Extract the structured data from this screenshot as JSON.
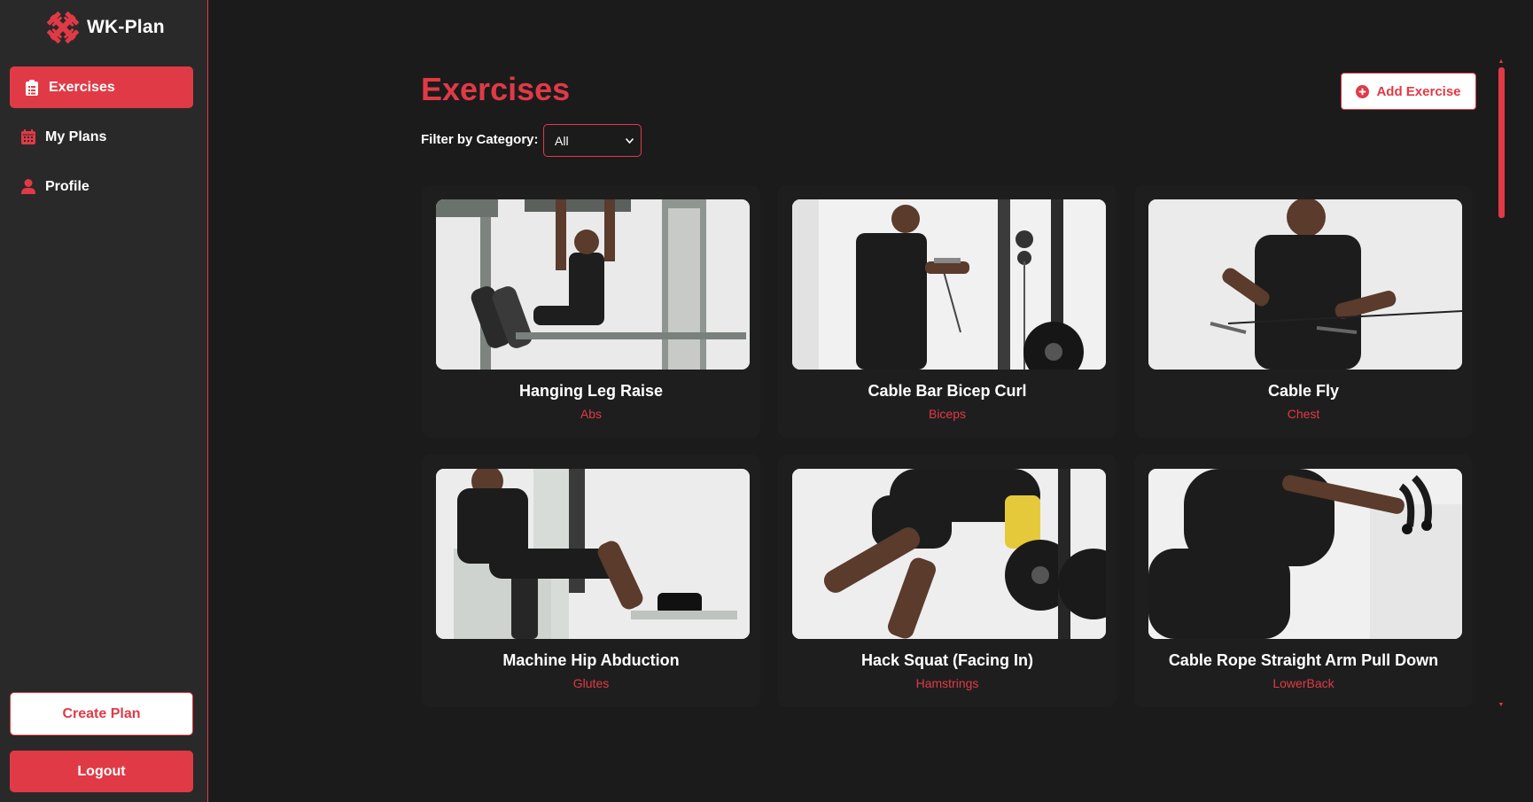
{
  "brand": {
    "name": "WK-Plan",
    "logo_icon": "crossed-dumbbells-icon"
  },
  "nav": [
    {
      "label": "Exercises",
      "icon": "clipboard-list-icon",
      "active": true
    },
    {
      "label": "My Plans",
      "icon": "calendar-icon",
      "active": false
    },
    {
      "label": "Profile",
      "icon": "user-icon",
      "active": false
    }
  ],
  "sidebar_actions": {
    "create_plan": "Create Plan",
    "logout": "Logout"
  },
  "page": {
    "title": "Exercises",
    "add_button": "Add Exercise",
    "add_icon": "plus-circle-icon",
    "filter_label": "Filter by Category:",
    "filter_value": "All"
  },
  "exercises": [
    {
      "name": "Hanging Leg Raise",
      "category": "Abs"
    },
    {
      "name": "Cable Bar Bicep Curl",
      "category": "Biceps"
    },
    {
      "name": "Cable Fly",
      "category": "Chest"
    },
    {
      "name": "Machine Hip Abduction",
      "category": "Glutes"
    },
    {
      "name": "Hack Squat (Facing In)",
      "category": "Hamstrings"
    },
    {
      "name": "Cable Rope Straight Arm Pull Down",
      "category": "LowerBack"
    }
  ],
  "colors": {
    "accent": "#e03a46",
    "background": "#1c1b1c",
    "sidebar": "#2a292a"
  }
}
